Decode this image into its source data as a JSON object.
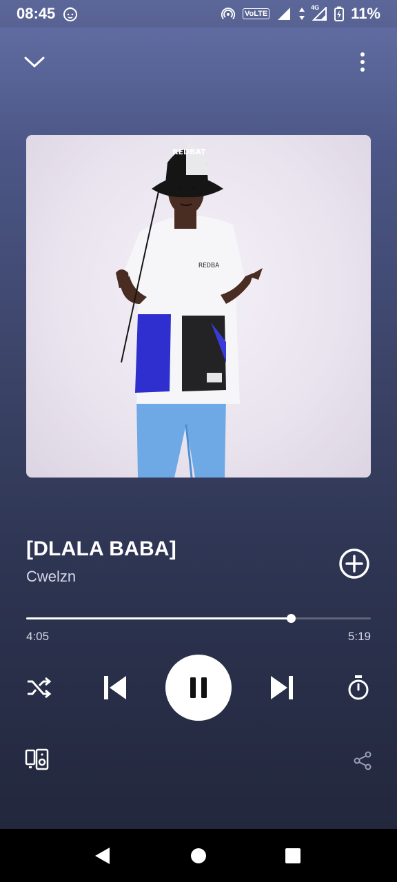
{
  "status_bar": {
    "time": "08:45",
    "network": "VoLTE",
    "network_type": "4G",
    "battery": "11%"
  },
  "player": {
    "title": "[DLALA BABA]",
    "artist": "Cwelzn",
    "elapsed": "4:05",
    "duration": "5:19",
    "progress_fraction": 0.768,
    "state": "playing"
  },
  "artwork": {
    "hat_text": "REDBAT",
    "shirt_text": "REDBA"
  },
  "colors": {
    "accent": "#ffffff",
    "background_top": "#6470a6",
    "background_bottom": "#22273c"
  },
  "icons": {
    "collapse": "chevron-down-icon",
    "more": "more-vertical-icon",
    "add": "add-circle-icon",
    "shuffle": "shuffle-icon",
    "previous": "skip-previous-icon",
    "pause": "pause-icon",
    "next": "skip-next-icon",
    "timer": "sleep-timer-icon",
    "devices": "connect-device-icon",
    "share": "share-icon"
  }
}
